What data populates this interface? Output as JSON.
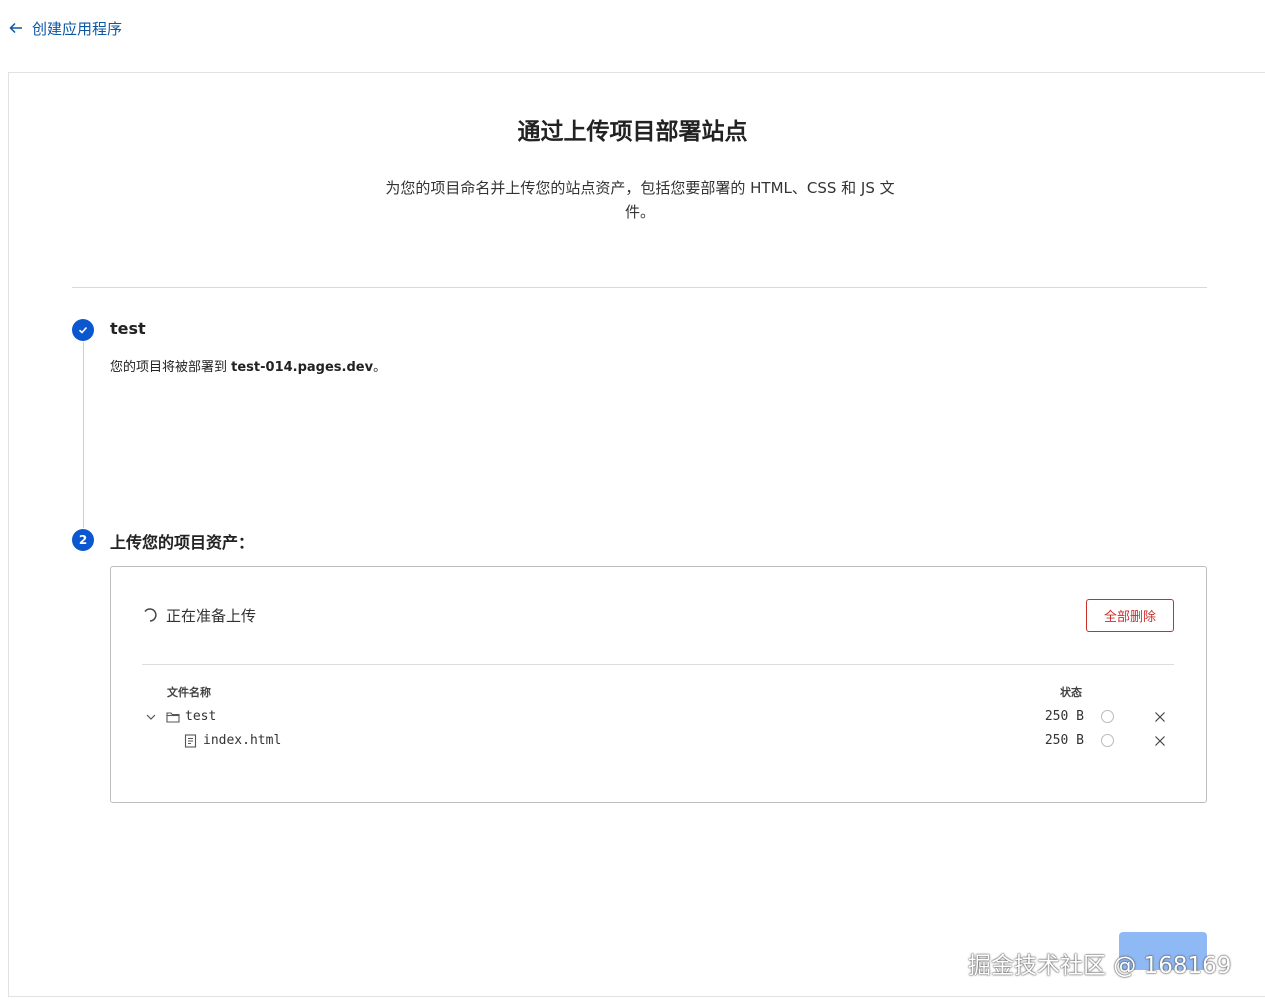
{
  "header": {
    "back_label": "创建应用程序"
  },
  "main": {
    "title": "通过上传项目部署站点",
    "subtitle": "为您的项目命名并上传您的站点资产，包括您要部署的 HTML、CSS 和 JS 文件。"
  },
  "step1": {
    "name": "test",
    "desc_prefix": "您的项目将被部署到 ",
    "domain": "test-014.pages.dev",
    "desc_suffix": "。"
  },
  "step2": {
    "number": "2",
    "title": "上传您的项目资产：",
    "status_text": "正在准备上传",
    "delete_all_label": "全部删除",
    "columns": {
      "name": "文件名称",
      "status": "状态"
    },
    "files": [
      {
        "name": "test",
        "size": "250 B",
        "type": "folder"
      },
      {
        "name": "index.html",
        "size": "250 B",
        "type": "file"
      }
    ]
  },
  "watermark": "掘金技术社区 @ 168169"
}
